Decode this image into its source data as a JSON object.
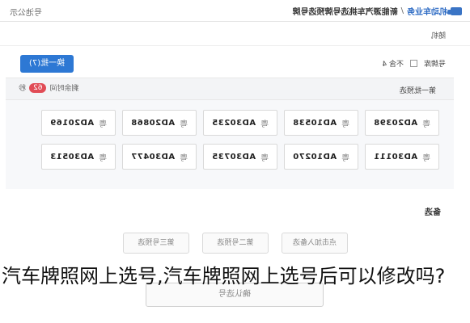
{
  "header": {
    "module": "机动车业务",
    "separator": "/",
    "page": "新能源汽车挑选号牌预选号牌",
    "right_label": "号池公示"
  },
  "subheader": {
    "title": "随机"
  },
  "pool": {
    "label": "号牌库",
    "option_label": "不含 4",
    "refresh_button": "换一批(7)"
  },
  "batch": {
    "label": "第一批预选",
    "timer_prefix": "剩余时间",
    "timer_value": "62",
    "timer_unit": "秒"
  },
  "plates": [
    {
      "prefix": "粤",
      "number": "AD20398"
    },
    {
      "prefix": "粤",
      "number": "AD10538"
    },
    {
      "prefix": "粤",
      "number": "AD30235"
    },
    {
      "prefix": "粤",
      "number": "AD20868"
    },
    {
      "prefix": "粤",
      "number": "AD20169"
    },
    {
      "prefix": "粤",
      "number": "AD30111"
    },
    {
      "prefix": "粤",
      "number": "AD10270"
    },
    {
      "prefix": "粤",
      "number": "AD30735"
    },
    {
      "prefix": "粤",
      "number": "AD30477"
    },
    {
      "prefix": "粤",
      "number": "AD30513"
    }
  ],
  "selection": {
    "title": "备选",
    "choices": [
      "点击加入备选",
      "第二号预选",
      "第三号预选"
    ],
    "confirm": "确认选号"
  },
  "caption": "汽车牌照网上选号,汽车牌照网上选号后可以修改吗?"
}
